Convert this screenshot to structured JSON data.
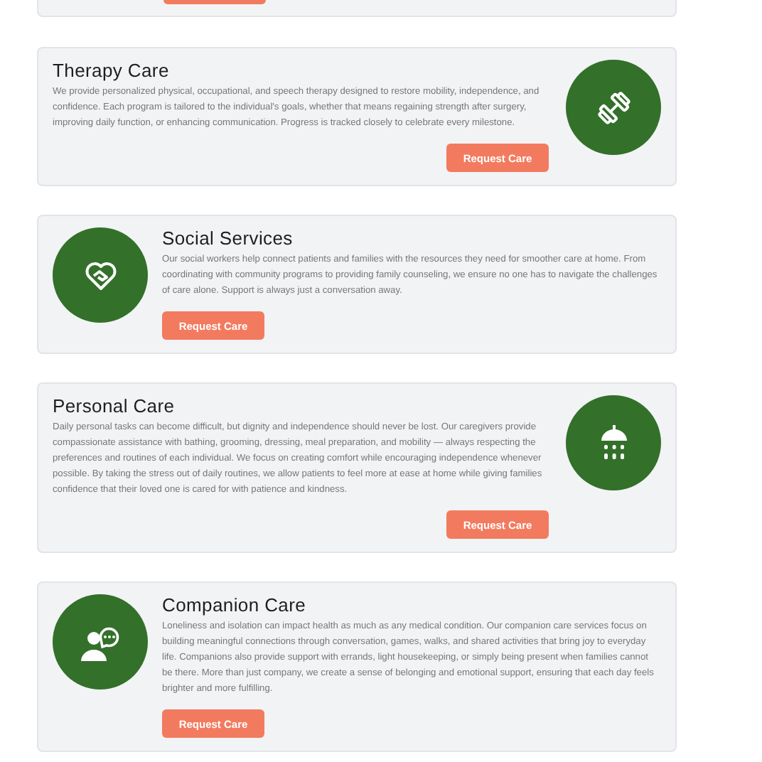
{
  "services": [
    {
      "title": "Therapy Care",
      "description": "We provide personalized physical, occupational, and speech therapy designed to restore mobility, independence, and confidence. Each program is tailored to the individual's goals, whether that means regaining strength after surgery, improving daily function, or enhancing communication. Progress is tracked closely to celebrate every milestone.",
      "button": "Request Care"
    },
    {
      "title": "Social Services",
      "description": "Our social workers help connect patients and families with the resources they need for smoother care at home. From coordinating with community programs to providing family counseling, we ensure no one has to navigate the challenges of care alone. Support is always just a conversation away.",
      "button": "Request Care"
    },
    {
      "title": "Personal Care",
      "description": "Daily personal tasks can become difficult, but dignity and independence should never be lost. Our caregivers provide compassionate assistance with bathing, grooming, dressing, meal preparation, and mobility — always respecting the preferences and routines of each individual. We focus on creating comfort while encouraging independence whenever possible. By taking the stress out of daily routines, we allow patients to feel more at ease at home while giving families confidence that their loved one is cared for with patience and kindness.",
      "button": "Request Care"
    },
    {
      "title": "Companion Care",
      "description": "Loneliness and isolation can impact health as much as any medical condition. Our companion care services focus on building meaningful connections through conversation, games, walks, and shared activities that bring joy to everyday life. Companions also provide support with errands, light housekeeping, or simply being present when families cannot be there. More than just company, we create a sense of belonging and emotional support, ensuring that each day feels brighter and more fulfilling.",
      "button": "Request Care"
    }
  ]
}
